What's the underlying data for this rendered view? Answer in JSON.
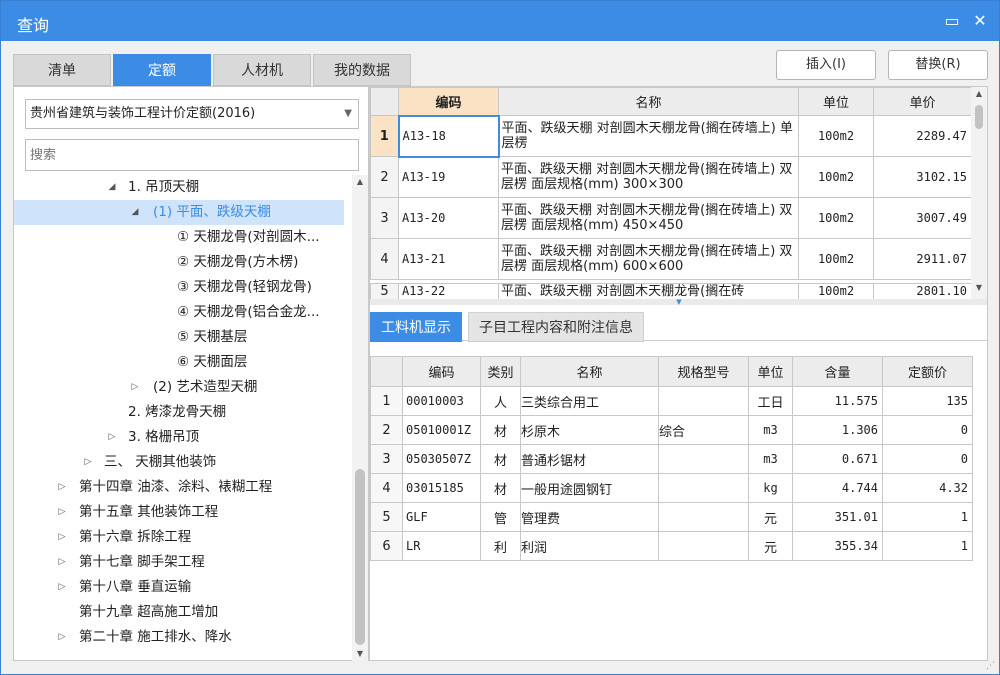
{
  "window": {
    "title": "查询"
  },
  "tabs": [
    "清单",
    "定额",
    "人材机",
    "我的数据"
  ],
  "buttons": {
    "insert": "插入(I)",
    "replace": "替换(R)"
  },
  "library": {
    "selected": "贵州省建筑与装饰工程计价定额(2016)"
  },
  "search": {
    "placeholder": "搜索"
  },
  "tree": [
    "1. 吊顶天棚",
    "(1) 平面、跌级天棚",
    "① 天棚龙骨(对剖圆木...",
    "② 天棚龙骨(方木楞)",
    "③ 天棚龙骨(轻钢龙骨)",
    "④ 天棚龙骨(铝合金龙...",
    "⑤ 天棚基层",
    "⑥ 天棚面层",
    "(2) 艺术造型天棚",
    "2. 烤漆龙骨天棚",
    "3. 格栅吊顶",
    "三、 天棚其他装饰",
    "第十四章 油漆、涂料、裱糊工程",
    "第十五章 其他装饰工程",
    "第十六章 拆除工程",
    "第十七章 脚手架工程",
    "第十八章 垂直运输",
    "第十九章 超高施工增加",
    "第二十章 施工排水、降水"
  ],
  "quota_table": {
    "headers": [
      "编码",
      "名称",
      "单位",
      "单价"
    ],
    "rows": [
      {
        "no": "1",
        "code": "A13-18",
        "name": "平面、跌级天棚 对剖圆木天棚龙骨(搁在砖墙上) 单层楞",
        "unit": "100m2",
        "price": "2289.47"
      },
      {
        "no": "2",
        "code": "A13-19",
        "name": "平面、跌级天棚 对剖圆木天棚龙骨(搁在砖墙上) 双层楞 面层规格(mm) 300×300",
        "unit": "100m2",
        "price": "3102.15"
      },
      {
        "no": "3",
        "code": "A13-20",
        "name": "平面、跌级天棚 对剖圆木天棚龙骨(搁在砖墙上) 双层楞 面层规格(mm) 450×450",
        "unit": "100m2",
        "price": "3007.49"
      },
      {
        "no": "4",
        "code": "A13-21",
        "name": "平面、跌级天棚 对剖圆木天棚龙骨(搁在砖墙上) 双层楞 面层规格(mm) 600×600",
        "unit": "100m2",
        "price": "2911.07"
      },
      {
        "no": "5",
        "code": "A13-22",
        "name": "平面、跌级天棚 对剖圆木天棚龙骨(搁在砖",
        "unit": "100m2",
        "price": "2801.10"
      }
    ]
  },
  "bottom_tabs": [
    "工料机显示",
    "子目工程内容和附注信息"
  ],
  "materials_table": {
    "headers": [
      "编码",
      "类别",
      "名称",
      "规格型号",
      "单位",
      "含量",
      "定额价"
    ],
    "rows": [
      {
        "no": "1",
        "code": "00010003",
        "type": "人",
        "name": "三类综合用工",
        "spec": "",
        "unit": "工日",
        "qty": "11.575",
        "price": "135"
      },
      {
        "no": "2",
        "code": "05010001Z",
        "type": "材",
        "name": "杉原木",
        "spec": "综合",
        "unit": "m3",
        "qty": "1.306",
        "price": "0"
      },
      {
        "no": "3",
        "code": "05030507Z",
        "type": "材",
        "name": "普通杉锯材",
        "spec": "",
        "unit": "m3",
        "qty": "0.671",
        "price": "0"
      },
      {
        "no": "4",
        "code": "03015185",
        "type": "材",
        "name": "一般用途圆钢钉",
        "spec": "",
        "unit": "kg",
        "qty": "4.744",
        "price": "4.32"
      },
      {
        "no": "5",
        "code": "GLF",
        "type": "管",
        "name": "管理费",
        "spec": "",
        "unit": "元",
        "qty": "351.01",
        "price": "1"
      },
      {
        "no": "6",
        "code": "LR",
        "type": "利",
        "name": "利润",
        "spec": "",
        "unit": "元",
        "qty": "355.34",
        "price": "1"
      }
    ]
  },
  "colors": {
    "accent": "#3c8ce6",
    "selected_header": "#fce2c4",
    "tree_selected": "#cfe3fa"
  }
}
